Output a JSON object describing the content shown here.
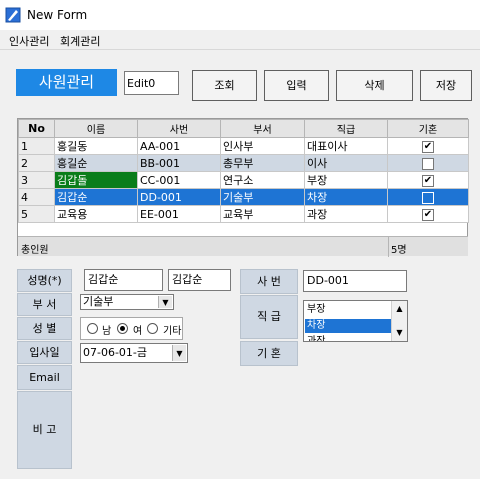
{
  "window": {
    "title": "New Form",
    "icon": "app-form-icon"
  },
  "menu": [
    "인사관리",
    "회계관리"
  ],
  "header": {
    "title": "사원관리",
    "edit0_value": "Edit0",
    "buttons": {
      "search": "조회",
      "insert": "입력",
      "delete": "삭제",
      "save": "저장"
    }
  },
  "grid": {
    "columns": [
      "No",
      "이름",
      "사번",
      "부서",
      "직급",
      "기혼"
    ],
    "rows": [
      {
        "no": "1",
        "name": "홍길동",
        "id": "AA-001",
        "dept": "인사부",
        "rank": "대표이사",
        "married": true
      },
      {
        "no": "2",
        "name": "홍길순",
        "id": "BB-001",
        "dept": "총무부",
        "rank": "이사",
        "married": false
      },
      {
        "no": "3",
        "name": "김갑돌",
        "id": "CC-001",
        "dept": "연구소",
        "rank": "부장",
        "married": true
      },
      {
        "no": "4",
        "name": "김갑순",
        "id": "DD-001",
        "dept": "기술부",
        "rank": "차장",
        "married": false
      },
      {
        "no": "5",
        "name": "교육용",
        "id": "EE-001",
        "dept": "교육부",
        "rank": "과장",
        "married": true
      }
    ],
    "footer_label": "총인원",
    "footer_count": "5명",
    "colors": {
      "selected_row": "#1e74d4",
      "highlight_cell": "#0a7d1a",
      "alt_row": "#cfd8e3"
    }
  },
  "form": {
    "labels": {
      "name": "성명(*)",
      "dept": "부 서",
      "gender": "성 별",
      "hire_date": "입사일",
      "email": "Email",
      "memo": "비 고",
      "id": "사 번",
      "rank": "직 급",
      "married": "기 혼"
    },
    "name_value": "김갑순",
    "name_alt_value": "김갑순",
    "dept_value": "기술부",
    "gender_options": [
      "남",
      "여",
      "기타"
    ],
    "gender_selected": "여",
    "hire_date_value": "07-06-01-금",
    "id_value": "DD-001",
    "rank_options": [
      "부장",
      "차장",
      "과장"
    ],
    "rank_selected": "차장"
  }
}
